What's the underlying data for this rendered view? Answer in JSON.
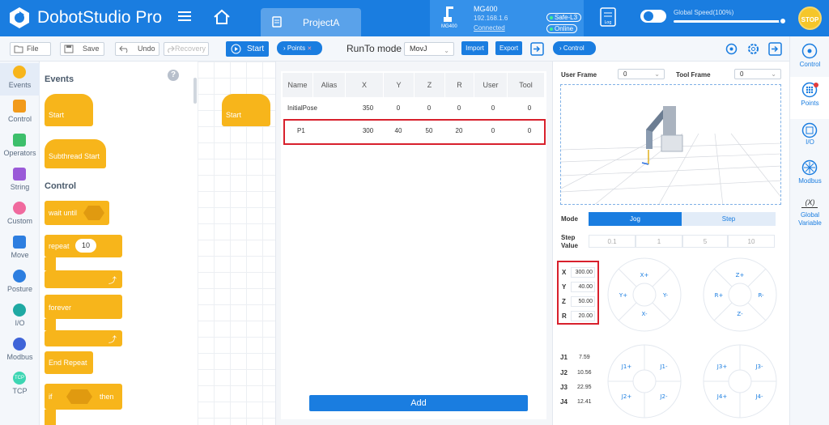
{
  "header": {
    "app_name": "DobotStudio Pro",
    "project_tab": "ProjectA",
    "device": {
      "model_icon_label": "MG400",
      "name": "MG400",
      "ip": "192.168.1.6",
      "connection": "Connected"
    },
    "badges": {
      "safety": "Safe-L3",
      "status": "Online"
    },
    "log_icon_label": "Log",
    "speed_label": "Global Speed(100%)",
    "speed_percent": 100,
    "stop_label": "STOP"
  },
  "toolbar": {
    "file": "File",
    "save": "Save",
    "undo": "Undo",
    "recovery": "Recovery",
    "start": "Start",
    "points_pill": "Points",
    "runto_label": "RunTo mode",
    "runto_value": "MovJ",
    "import": "Import",
    "export": "Export",
    "control_pill": "Control"
  },
  "categories": [
    "Events",
    "Control",
    "Operators",
    "String",
    "Custom",
    "Move",
    "Posture",
    "I/O",
    "Modbus",
    "TCP"
  ],
  "category_icon_text": {
    "tcp": "TCP"
  },
  "palette": {
    "events_title": "Events",
    "control_title": "Control",
    "start": "Start",
    "subthread_start": "Subthread Start",
    "wait_until": "wait until",
    "repeat": "repeat",
    "repeat_count": "10",
    "forever": "forever",
    "end_repeat": "End Repeat",
    "if": "if",
    "then": "then",
    "help": "?"
  },
  "workspace": {
    "start_block": "Start"
  },
  "points_table": {
    "headers": [
      "Name",
      "Alias",
      "X",
      "Y",
      "Z",
      "R",
      "User",
      "Tool"
    ],
    "rows": [
      [
        "InitialPose",
        "",
        "350",
        "0",
        "0",
        "0",
        "0",
        "0"
      ],
      [
        "P1",
        "",
        "300",
        "40",
        "50",
        "20",
        "0",
        "0"
      ]
    ],
    "add_button": "Add"
  },
  "control_panel": {
    "user_frame_label": "User Frame",
    "user_frame_value": "0",
    "tool_frame_label": "Tool Frame",
    "tool_frame_value": "0",
    "mode_label": "Mode",
    "mode_jog": "Jog",
    "mode_step": "Step",
    "step_value_label": "Step Value",
    "step_values": [
      "0.1",
      "1",
      "5",
      "10"
    ],
    "coords": [
      {
        "axis": "X",
        "value": "300.00"
      },
      {
        "axis": "Y",
        "value": "40.00"
      },
      {
        "axis": "Z",
        "value": "50.00"
      },
      {
        "axis": "R",
        "value": "20.00"
      }
    ],
    "joints": [
      {
        "axis": "J1",
        "value": "7.59"
      },
      {
        "axis": "J2",
        "value": "10.56"
      },
      {
        "axis": "J3",
        "value": "22.95"
      },
      {
        "axis": "J4",
        "value": "12.41"
      }
    ],
    "jog_xy": {
      "up": "X+",
      "down": "X-",
      "left": "Y+",
      "right": "Y-"
    },
    "jog_zr": {
      "up": "Z+",
      "down": "Z-",
      "left": "R+",
      "right": "R-"
    },
    "jog_j12": {
      "tl": "J1+",
      "tr": "J1-",
      "bl": "J2+",
      "br": "J2-"
    },
    "jog_j34": {
      "tl": "J3+",
      "tr": "J3-",
      "bl": "J4+",
      "br": "J4-"
    }
  },
  "right_sidebar": [
    {
      "label": "Control"
    },
    {
      "label": "Points"
    },
    {
      "label": "I/O"
    },
    {
      "label": "Modbus"
    },
    {
      "label": "Global Variable",
      "icon_text": "(X)"
    }
  ],
  "colors": {
    "brand": "#1a7de0",
    "block": "#f7b51b",
    "highlight": "#d8202c"
  }
}
